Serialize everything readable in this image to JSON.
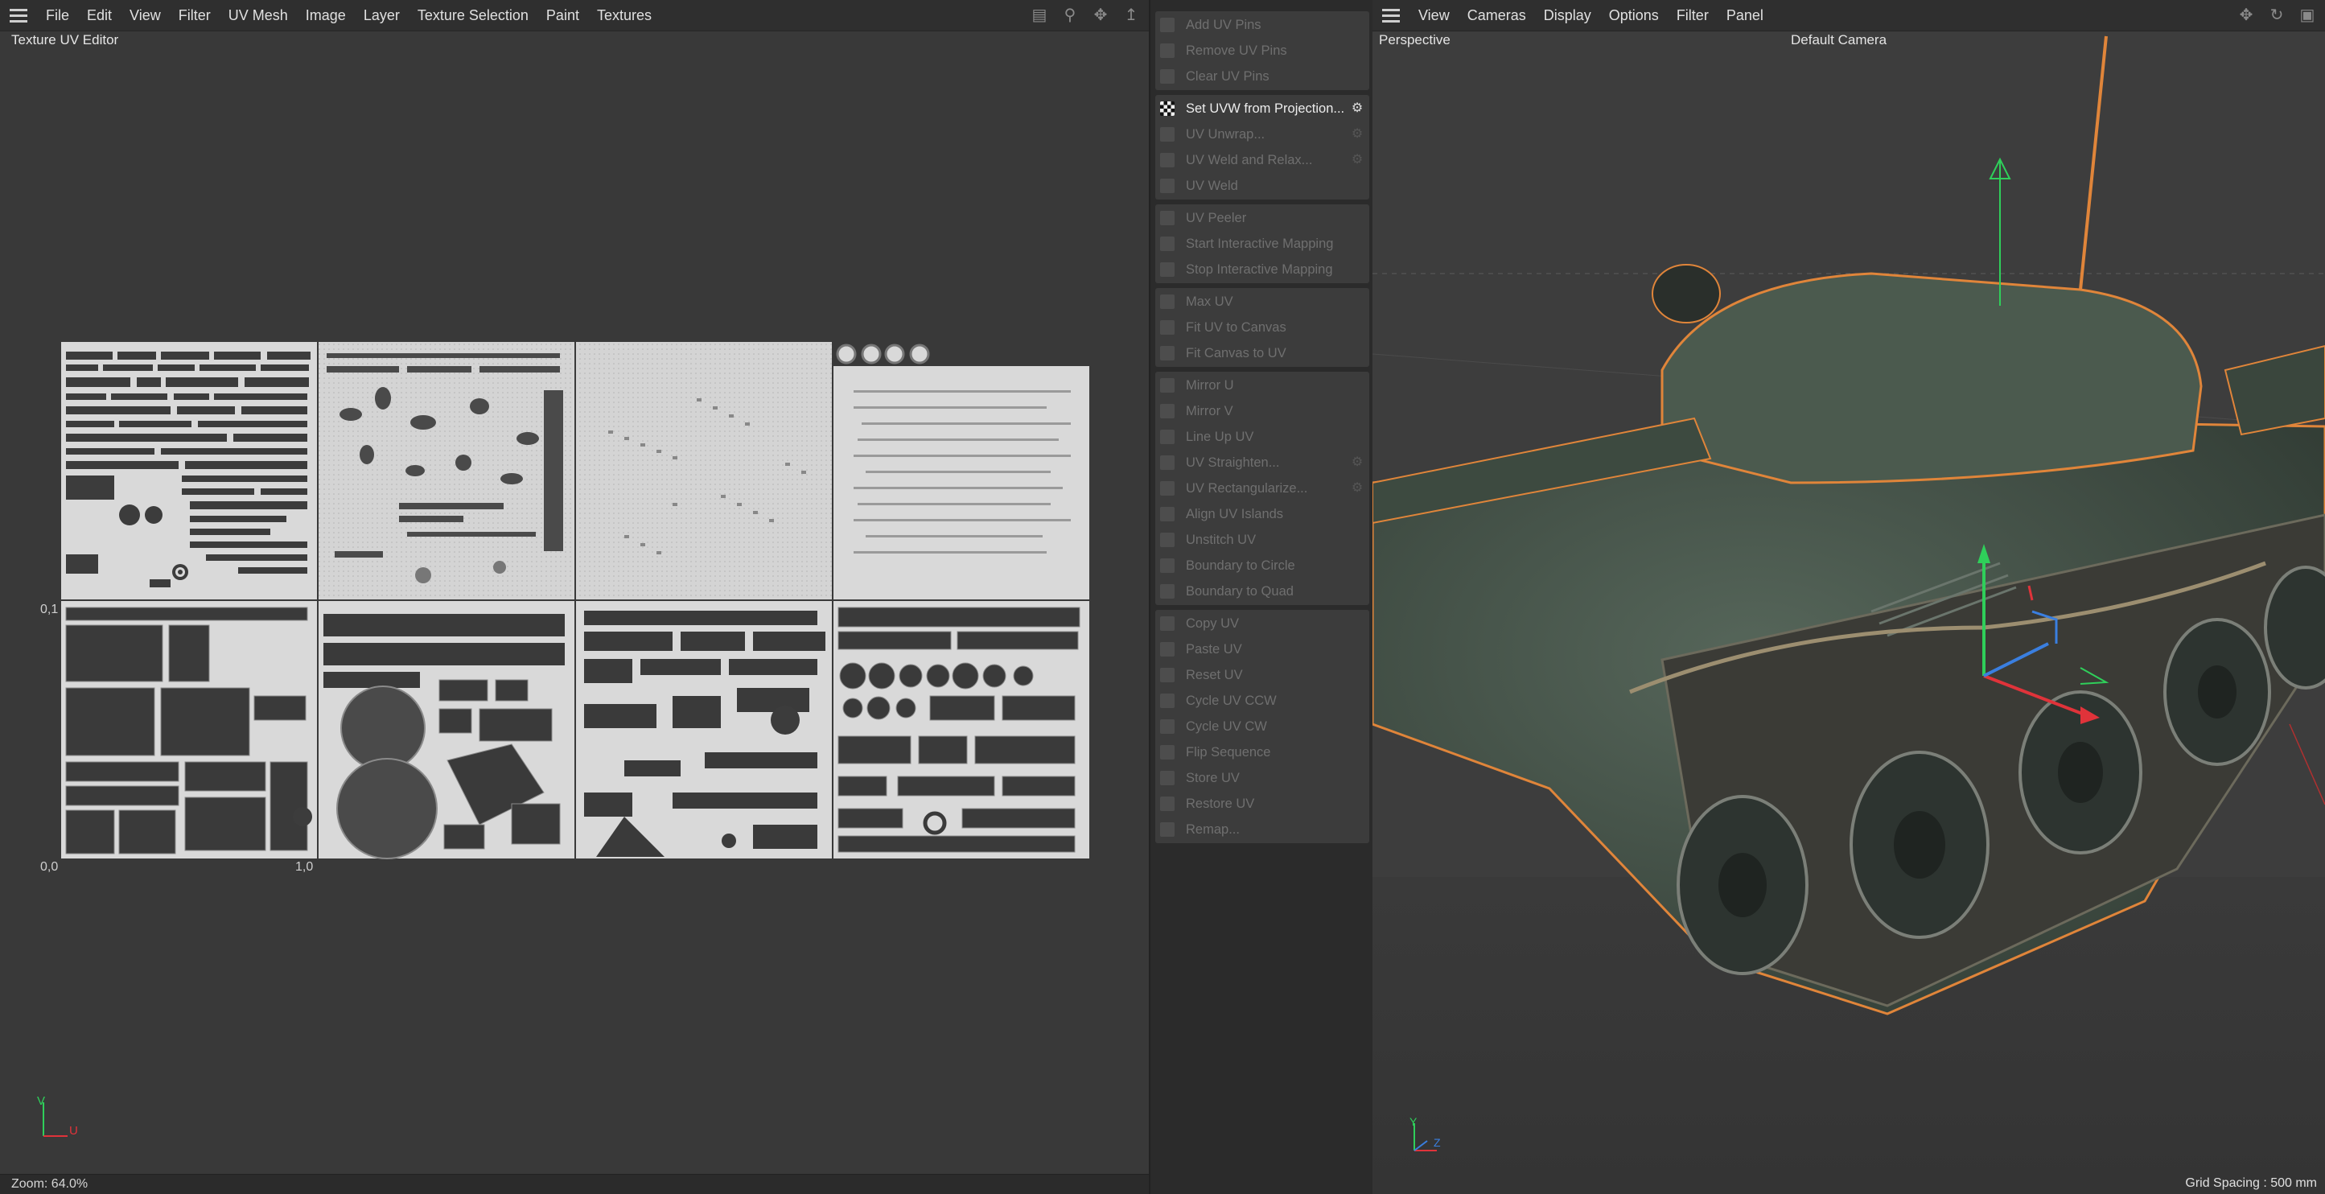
{
  "uv_editor": {
    "menu": [
      "File",
      "Edit",
      "View",
      "Filter",
      "UV Mesh",
      "Image",
      "Layer",
      "Texture Selection",
      "Paint",
      "Textures"
    ],
    "title": "Texture UV Editor",
    "axis_labels": {
      "v_mid": "0,1",
      "origin": "0,0",
      "u_mid": "1,0"
    },
    "gizmo": {
      "v": "V",
      "u": "U"
    },
    "status": "Zoom: 64.0%",
    "icons": [
      "chart-icon",
      "lock-icon",
      "move-icon",
      "arrow-icon"
    ]
  },
  "commands": {
    "groups": [
      [
        {
          "label": "Add UV Pins",
          "enabled": false
        },
        {
          "label": "Remove UV Pins",
          "enabled": false
        },
        {
          "label": "Clear UV Pins",
          "enabled": false
        }
      ],
      [
        {
          "label": "Set UVW from Projection...",
          "enabled": true,
          "gear": true
        },
        {
          "label": "UV Unwrap...",
          "enabled": false,
          "gear": true
        },
        {
          "label": "UV Weld and Relax...",
          "enabled": false,
          "gear": true
        },
        {
          "label": "UV Weld",
          "enabled": false
        }
      ],
      [
        {
          "label": "UV Peeler",
          "enabled": false
        },
        {
          "label": "Start Interactive Mapping",
          "enabled": false
        },
        {
          "label": "Stop Interactive Mapping",
          "enabled": false
        }
      ],
      [
        {
          "label": "Max UV",
          "enabled": false
        },
        {
          "label": "Fit UV to Canvas",
          "enabled": false
        },
        {
          "label": "Fit Canvas to UV",
          "enabled": false
        }
      ],
      [
        {
          "label": "Mirror U",
          "enabled": false
        },
        {
          "label": "Mirror V",
          "enabled": false
        },
        {
          "label": "Line Up UV",
          "enabled": false
        },
        {
          "label": "UV Straighten...",
          "enabled": false,
          "gear": true
        },
        {
          "label": "UV Rectangularize...",
          "enabled": false,
          "gear": true
        },
        {
          "label": "Align UV Islands",
          "enabled": false
        },
        {
          "label": "Unstitch UV",
          "enabled": false
        },
        {
          "label": "Boundary to Circle",
          "enabled": false
        },
        {
          "label": "Boundary to Quad",
          "enabled": false
        }
      ],
      [
        {
          "label": "Copy UV",
          "enabled": false
        },
        {
          "label": "Paste UV",
          "enabled": false
        },
        {
          "label": "Reset UV",
          "enabled": false
        },
        {
          "label": "Cycle UV CCW",
          "enabled": false
        },
        {
          "label": "Cycle UV CW",
          "enabled": false
        },
        {
          "label": "Flip Sequence",
          "enabled": false
        },
        {
          "label": "Store UV",
          "enabled": false
        },
        {
          "label": "Restore UV",
          "enabled": false
        },
        {
          "label": "Remap...",
          "enabled": false
        }
      ]
    ]
  },
  "viewport": {
    "menu": [
      "View",
      "Cameras",
      "Display",
      "Options",
      "Filter",
      "Panel"
    ],
    "projection": "Perspective",
    "camera": "Default Camera",
    "grid_spacing": "Grid Spacing : 500 mm",
    "gizmo": {
      "y": "Y",
      "z": "Z"
    },
    "colors": {
      "selection_outline": "#e0853a",
      "hull": "#3f4a40",
      "x_axis": "#e0333a",
      "y_axis": "#2fcf5a",
      "z_axis": "#3a7fe0"
    },
    "icons": [
      "move-icon",
      "rotate-icon",
      "scale-icon"
    ]
  }
}
